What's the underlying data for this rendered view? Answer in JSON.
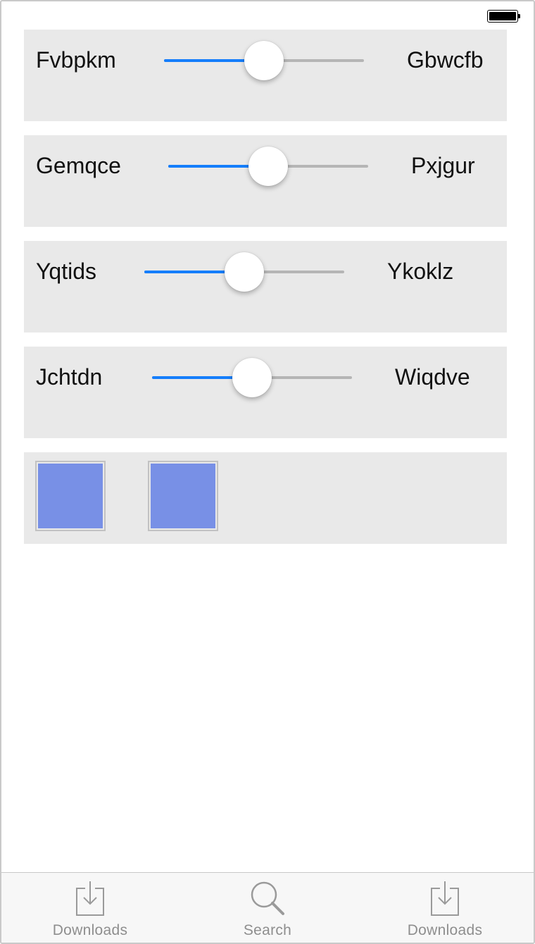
{
  "colors": {
    "accent": "#157efb",
    "track": "#b5b5b5",
    "panel": "#e9e9e9",
    "swatch": "#7890e6",
    "tab_inactive": "#8e8e8e"
  },
  "status_bar": {
    "battery_icon": "battery-full-icon"
  },
  "sliders": [
    {
      "left_label": "Fvbpkm",
      "right_label": "Gbwcfb",
      "value": 0.5
    },
    {
      "left_label": "Gemqce",
      "right_label": "Pxjgur",
      "value": 0.5
    },
    {
      "left_label": "Yqtids",
      "right_label": "Ykoklz",
      "value": 0.5
    },
    {
      "left_label": "Jchtdn",
      "right_label": "Wiqdve",
      "value": 0.5
    }
  ],
  "swatches": [
    {
      "color": "#7890e6"
    },
    {
      "color": "#7890e6"
    }
  ],
  "tab_bar": {
    "tabs": [
      {
        "label": "Downloads",
        "icon": "download-icon"
      },
      {
        "label": "Search",
        "icon": "search-icon"
      },
      {
        "label": "Downloads",
        "icon": "download-icon"
      }
    ]
  }
}
